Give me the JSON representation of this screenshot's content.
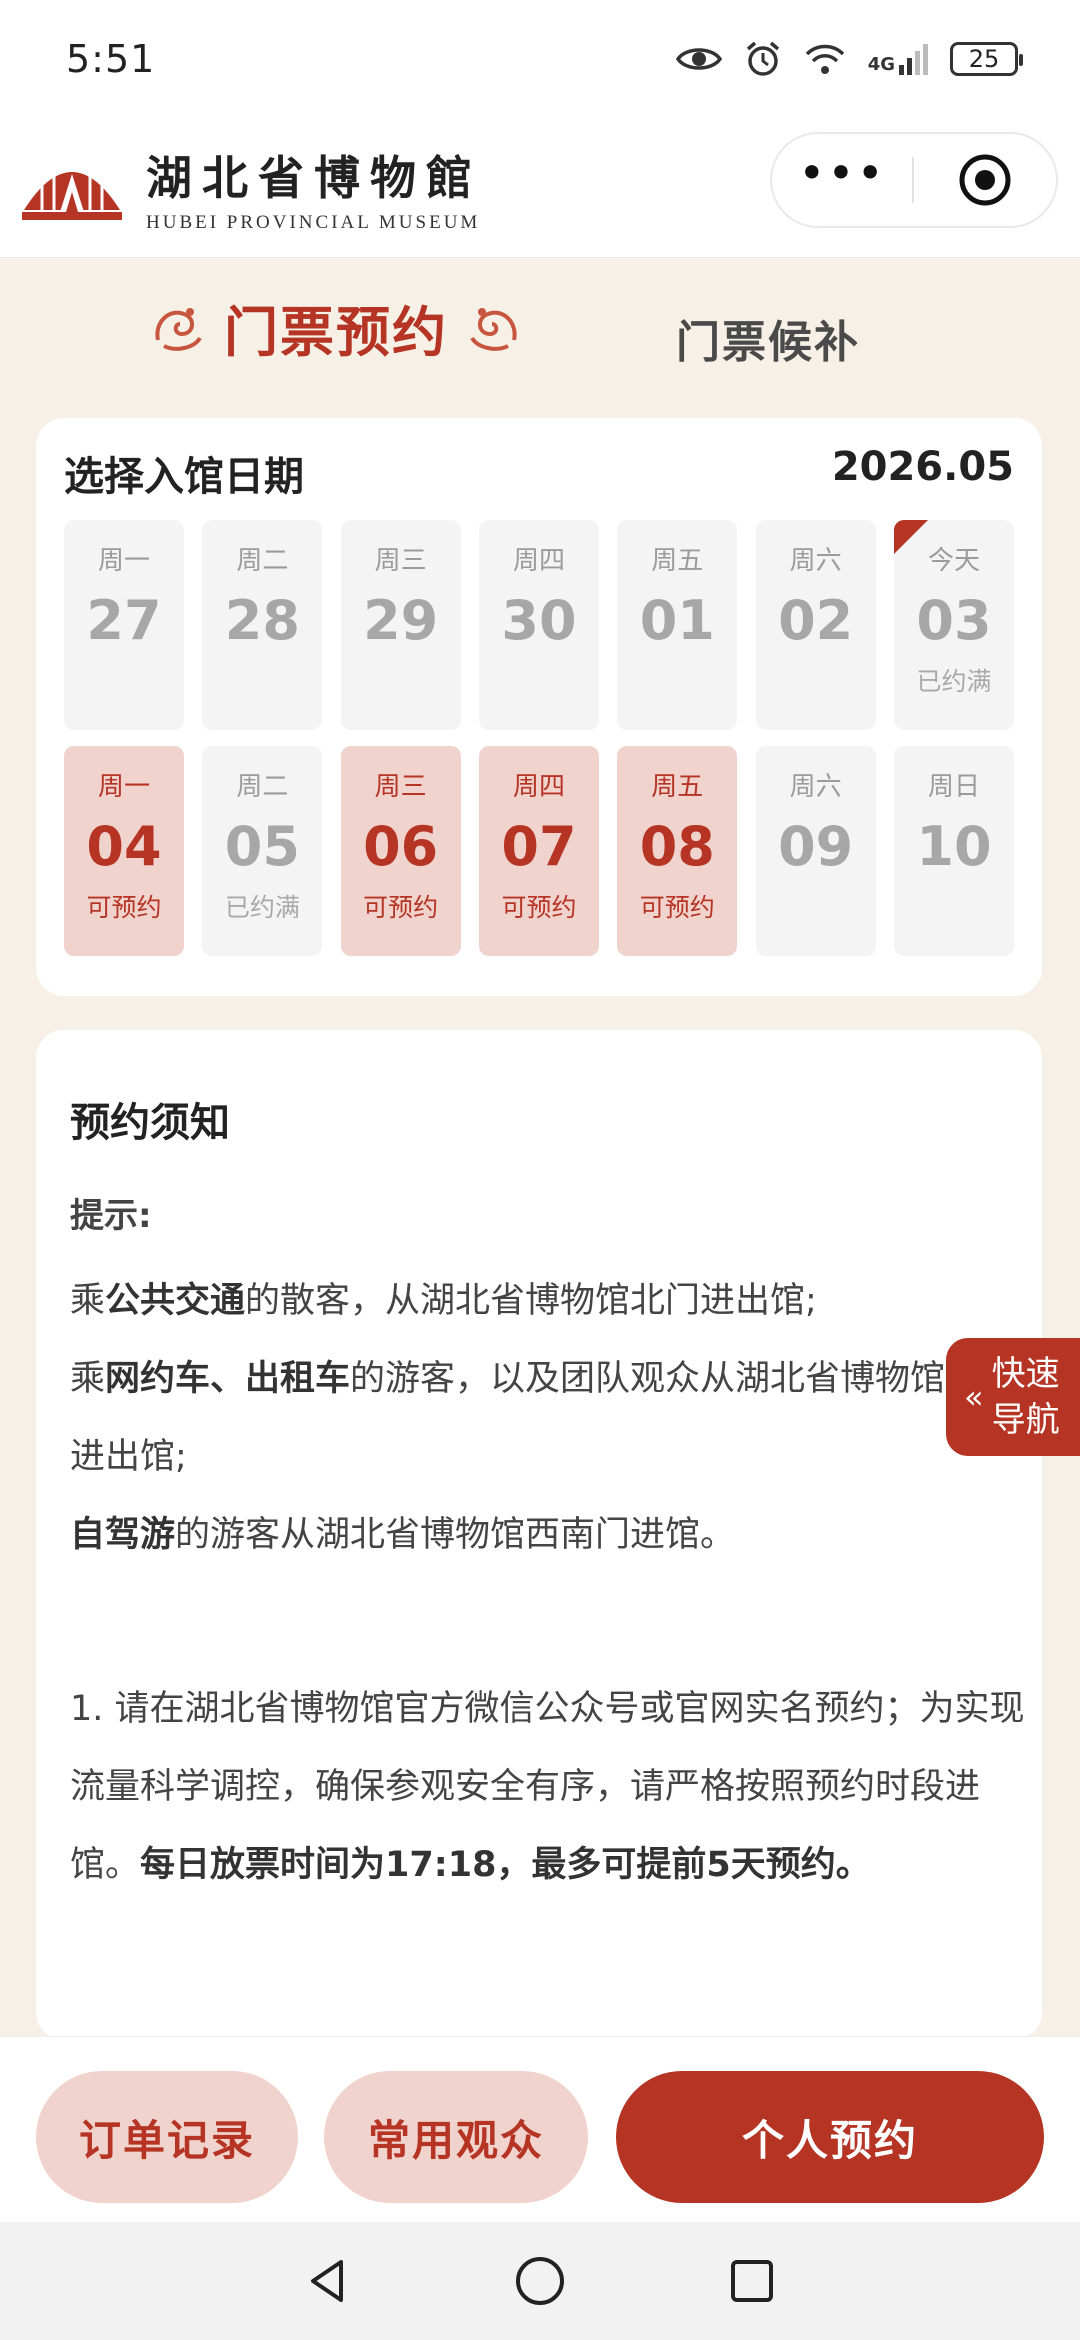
{
  "status_bar": {
    "time": "5:51",
    "network": "4G",
    "battery": "25"
  },
  "header": {
    "logo_cn": "湖北省博物館",
    "logo_en": "HUBEI PROVINCIAL MUSEUM"
  },
  "tabs": {
    "active": "门票预约",
    "other": "门票候补"
  },
  "date_picker": {
    "title": "选择入馆日期",
    "month": "2026.05",
    "rows": [
      [
        {
          "weekday": "周一",
          "day": "27",
          "status": "",
          "available": false
        },
        {
          "weekday": "周二",
          "day": "28",
          "status": "",
          "available": false
        },
        {
          "weekday": "周三",
          "day": "29",
          "status": "",
          "available": false
        },
        {
          "weekday": "周四",
          "day": "30",
          "status": "",
          "available": false
        },
        {
          "weekday": "周五",
          "day": "01",
          "status": "",
          "available": false
        },
        {
          "weekday": "周六",
          "day": "02",
          "status": "",
          "available": false
        },
        {
          "weekday": "今天",
          "day": "03",
          "status": "已约满",
          "available": false,
          "today": true
        }
      ],
      [
        {
          "weekday": "周一",
          "day": "04",
          "status": "可预约",
          "available": true
        },
        {
          "weekday": "周二",
          "day": "05",
          "status": "已约满",
          "available": false
        },
        {
          "weekday": "周三",
          "day": "06",
          "status": "可预约",
          "available": true
        },
        {
          "weekday": "周四",
          "day": "07",
          "status": "可预约",
          "available": true
        },
        {
          "weekday": "周五",
          "day": "08",
          "status": "可预约",
          "available": true
        },
        {
          "weekday": "周六",
          "day": "09",
          "status": "",
          "available": false
        },
        {
          "weekday": "周日",
          "day": "10",
          "status": "",
          "available": false
        }
      ]
    ]
  },
  "notice": {
    "heading": "预约须知",
    "tip": "提示:",
    "line1": {
      "a": "乘",
      "b": "公共交通",
      "c": "的散客，从湖北省博物馆北门进出馆;"
    },
    "line2": {
      "a": "乘",
      "b": "网约车、出租车",
      "c": "的游客，以及团队观众从湖北省博物馆南门进出馆;"
    },
    "line3": {
      "b": "自驾游",
      "c": "的游客从湖北省博物馆西南门进馆。"
    },
    "para1_a": "1. 请在湖北省博物馆官方微信公众号或官网实名预约；为实现流量科学调控，确保参观安全有序，请严格按照预约时段进馆。",
    "para1_b": "每日放票时间为17:18，最多可提前5天预约。"
  },
  "quick_nav": {
    "label": "快速导航"
  },
  "actions": {
    "orders": "订单记录",
    "visitors": "常用观众",
    "book": "个人预约"
  },
  "colors": {
    "brand": "#b53424",
    "brand_light": "#f1d3cd",
    "bg": "#f6f0e6"
  }
}
